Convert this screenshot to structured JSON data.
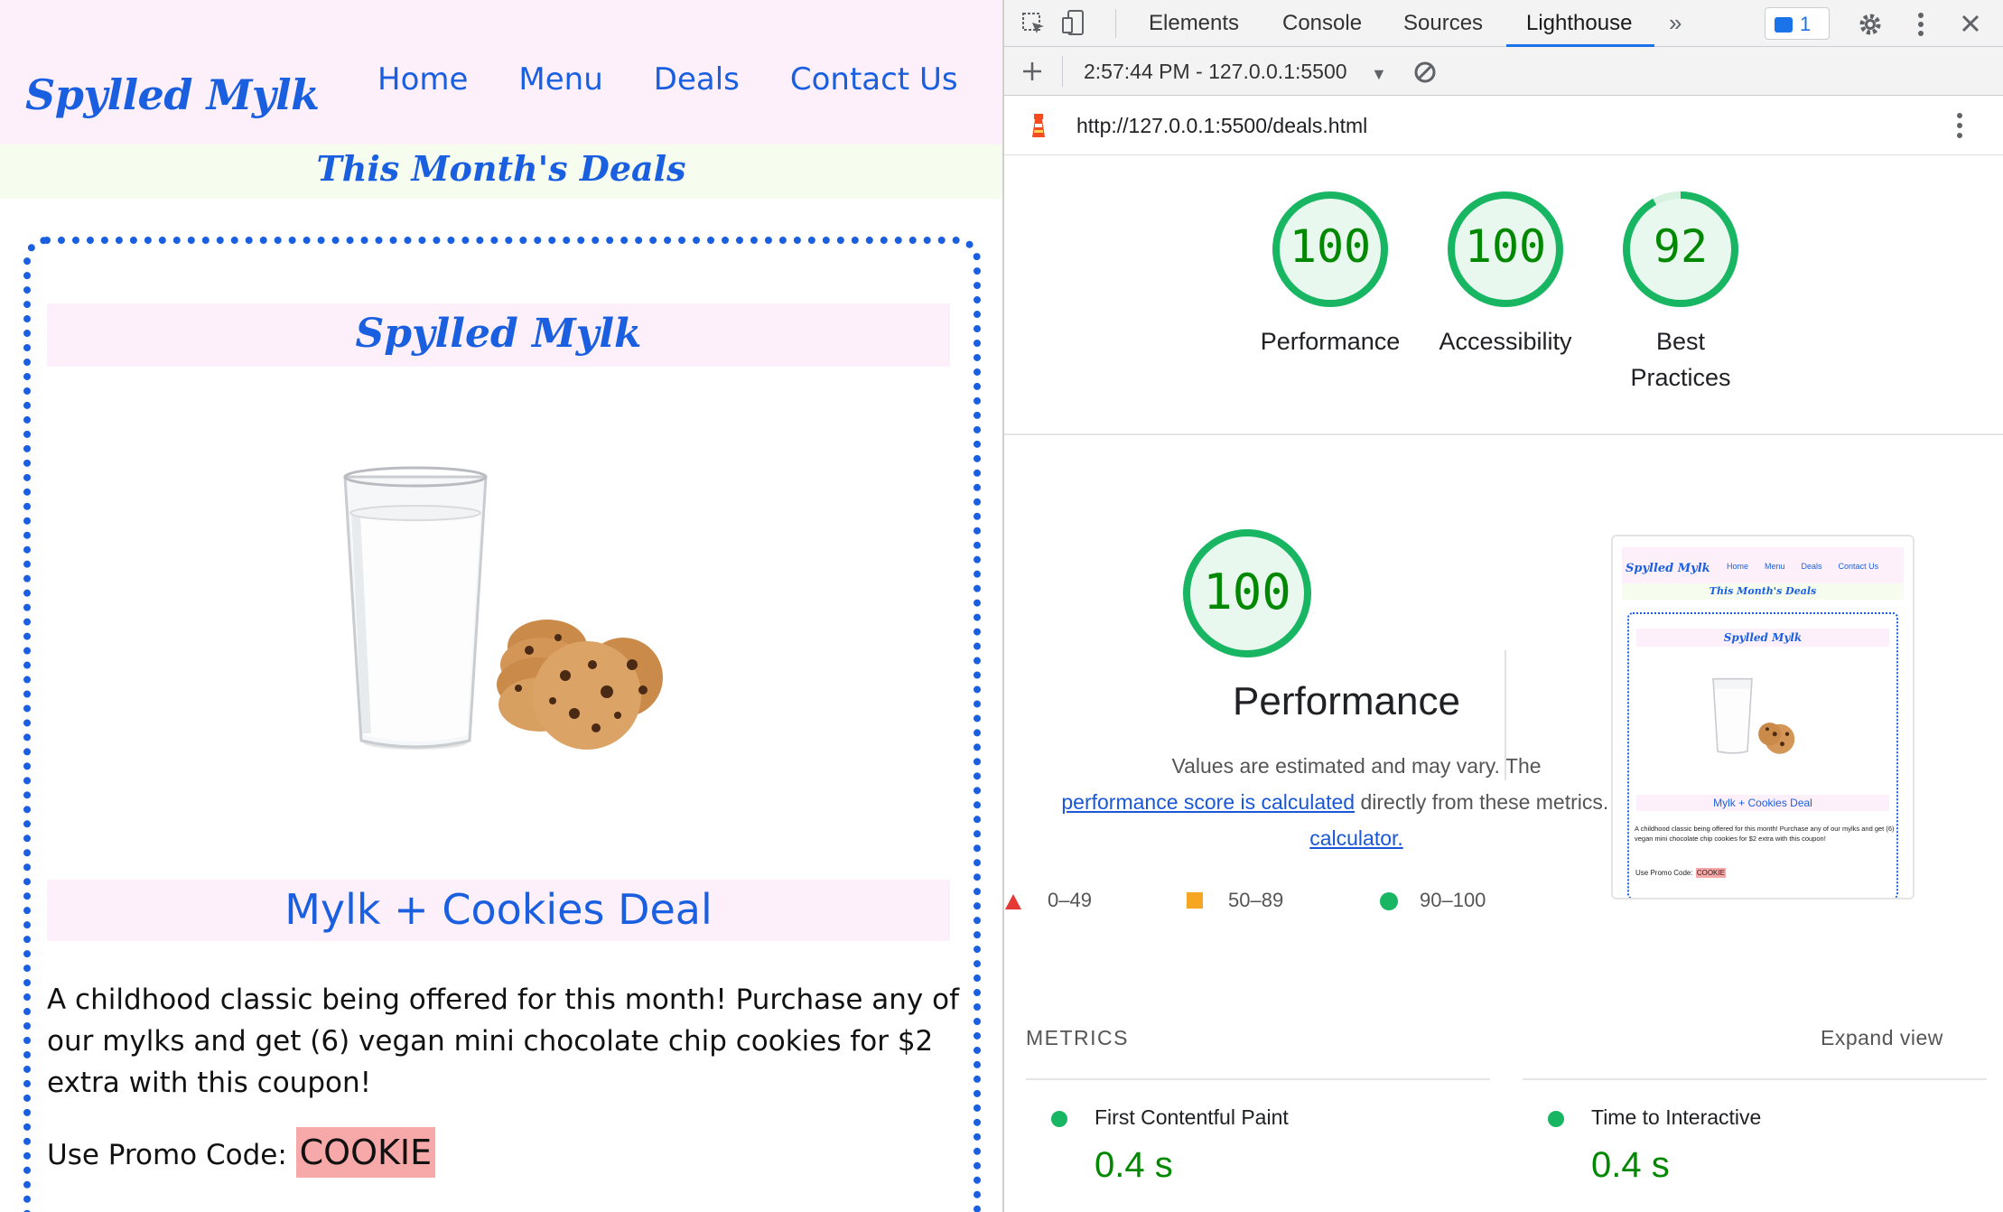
{
  "site": {
    "logo": "Spylled Mylk",
    "nav": [
      "Home",
      "Menu",
      "Deals",
      "Contact Us"
    ],
    "banner": "This Month's Deals",
    "card_title": "Spylled Mylk",
    "image_alt": "milk-and-cookies-image",
    "deal_title": "Mylk + Cookies Deal",
    "deal_description": "A childhood classic being offered for this month! Purchase any of our mylks and get (6) vegan mini chocolate chip cookies for $2 extra with this coupon!",
    "promo_label": "Use Promo Code:",
    "promo_code": "COOKIE",
    "colors": {
      "brand": "#1a5fe0",
      "header_bg": "#fdf0fa",
      "banner_bg": "#f6fdee",
      "promo_bg": "#f7a8a8"
    }
  },
  "devtools": {
    "tabs": [
      "Elements",
      "Console",
      "Sources",
      "Lighthouse"
    ],
    "active_tab": "Lighthouse",
    "more_tabs_icon": "chevron-double-right-icon",
    "issues_count": "1",
    "report_selector": "2:57:44 PM - 127.0.0.1:5500",
    "url": "http://127.0.0.1:5500/deals.html",
    "scores": [
      {
        "label": "Performance",
        "value": 100
      },
      {
        "label": "Accessibility",
        "value": 100
      },
      {
        "label": "Best Practices",
        "value": 92
      }
    ],
    "perf": {
      "score": 100,
      "title": "Performance",
      "desc_1": "Values are estimated and may vary. The",
      "link_1": "performance score is calculated",
      "desc_2": "directly from these metrics.",
      "link_2": "See calculator."
    },
    "legend": [
      {
        "range": "0–49",
        "color": "#e53935",
        "shape": "triangle"
      },
      {
        "range": "50–89",
        "color": "#f5a623",
        "shape": "square"
      },
      {
        "range": "90–100",
        "color": "#18b663",
        "shape": "circle"
      }
    ],
    "thumbnail": {
      "logo": "Spylled Mylk",
      "nav": [
        "Home",
        "Menu",
        "Deals",
        "Contact Us"
      ],
      "banner": "This Month's Deals",
      "card_title": "Spylled Mylk",
      "deal_title": "Mylk + Cookies Deal",
      "desc": "A childhood classic being offered for this month! Purchase any of our mylks and get (6) vegan mini chocolate chip cookies for $2 extra with this coupon!",
      "promo_label": "Use Promo Code:",
      "promo_code": "COOKIE"
    },
    "metrics": {
      "title": "METRICS",
      "expand": "Expand view",
      "items": [
        {
          "name": "First Contentful Paint",
          "value": "0.4 s"
        },
        {
          "name": "Time to Interactive",
          "value": "0.4 s"
        }
      ]
    },
    "colors": {
      "pass": "#18b663",
      "pass_text": "#008800",
      "accent": "#1a73e8"
    }
  }
}
